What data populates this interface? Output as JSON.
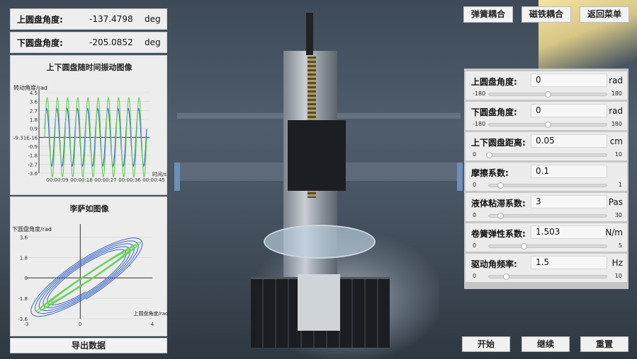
{
  "readouts": {
    "upper": {
      "label": "上圆盘角度:",
      "value": "-137.4798",
      "unit": "deg"
    },
    "lower": {
      "label": "下圆盘角度:",
      "value": "-205.0852",
      "unit": "deg"
    }
  },
  "top_buttons": {
    "spring": "弹簧耦合",
    "magnet": "磁铁耦合",
    "back": "返回菜单"
  },
  "params": [
    {
      "label": "上圆盘角度:",
      "value": "0",
      "unit": "rad",
      "min": "-180",
      "max": "180",
      "fraction": 0.5
    },
    {
      "label": "下圆盘角度:",
      "value": "0",
      "unit": "rad",
      "min": "-180",
      "max": "180",
      "fraction": 0.5
    },
    {
      "label": "上下圆盘距离:",
      "value": "0.05",
      "unit": "cm",
      "min": "0",
      "max": "10",
      "fraction": 0.005
    },
    {
      "label": "摩擦系数:",
      "value": "0.1",
      "unit": "",
      "min": "0",
      "max": "1",
      "fraction": 0.1
    },
    {
      "label": "液体粘滞系数:",
      "value": "3",
      "unit": "Pas",
      "min": "0",
      "max": "30",
      "fraction": 0.1
    },
    {
      "label": "卷簧弹性系数:",
      "value": "1.503",
      "unit": "N/m",
      "min": "0",
      "max": "5",
      "fraction": 0.3
    },
    {
      "label": "驱动角频率:",
      "value": "1.5",
      "unit": "Hz",
      "min": "0",
      "max": "10",
      "fraction": 0.15
    }
  ],
  "bottom_buttons": {
    "start": "开始",
    "resume": "继续",
    "reset": "重置"
  },
  "export_label": "导出数据",
  "colors": {
    "series_blue": "#3a64c4",
    "series_green": "#6fd060",
    "panel": "#ededed"
  },
  "chart_data": [
    {
      "type": "line",
      "title": "上下圆盘随时间振动图像",
      "ylabel": "转动角度/rad",
      "xlabel": "时间/s",
      "y_ticks": [
        "4.5",
        "3.6",
        "2.7",
        "1.8",
        "0.9",
        "-9.31E-16",
        "-0.9",
        "-1.8",
        "-2.7",
        "-3.6"
      ],
      "x_ticks": [
        "00:00:09",
        "00:00:18",
        "00:00:27",
        "00:00:36",
        "00:00:45"
      ],
      "ylim": [
        -3.6,
        4.5
      ],
      "series": [
        {
          "color": "#3a64c4",
          "amplitude": 2.9,
          "cycles": 10,
          "phase": 0.3
        },
        {
          "color": "#6fd060",
          "amplitude": 4.0,
          "cycles": 10,
          "phase": 0.0
        }
      ]
    },
    {
      "type": "line",
      "title": "李萨如图像",
      "ylabel": "下圆盘角度/rad",
      "xlabel": "上圆盘角度/rad",
      "y_ticks": [
        "3.6",
        "1.8",
        "0",
        "-1.8",
        "-3.6"
      ],
      "x_ticks": [
        "-3",
        "0",
        "4"
      ],
      "xlim": [
        -3,
        4
      ],
      "ylim": [
        -3.6,
        4.5
      ],
      "series": [
        {
          "color": "#3a64c4",
          "kind": "lissajous"
        },
        {
          "color": "#6fd060",
          "kind": "lissajous"
        }
      ]
    }
  ]
}
